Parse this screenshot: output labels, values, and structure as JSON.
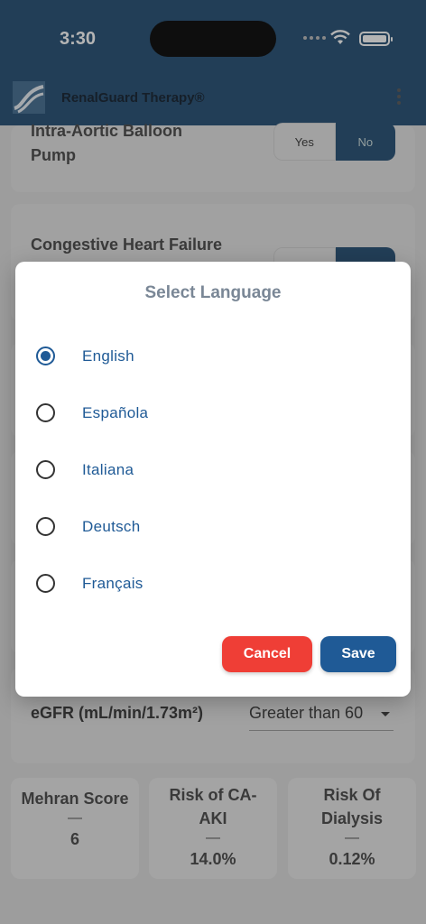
{
  "status_bar": {
    "time": "3:30"
  },
  "app": {
    "title": "RenalGuard Therapy®"
  },
  "background": {
    "balloon_pump": {
      "label_line1": "Intra-Aortic Balloon",
      "label_line2": "Pump",
      "yes": "Yes",
      "no": "No"
    },
    "heart_failure": {
      "label": "Congestive Heart Failure"
    },
    "egfr": {
      "label": "eGFR (mL/min/1.73m²)",
      "value": "Greater than 60"
    },
    "scores": [
      {
        "title": "Mehran Score",
        "dash": "—",
        "value": "6"
      },
      {
        "title": "Risk of CA-AKI",
        "dash": "—",
        "value": "14.0%"
      },
      {
        "title": "Risk Of Dialysis",
        "dash": "—",
        "value": "0.12%"
      }
    ]
  },
  "dialog": {
    "title": "Select Language",
    "options": [
      {
        "label": "English",
        "selected": true
      },
      {
        "label": "Española",
        "selected": false
      },
      {
        "label": "Italiana",
        "selected": false
      },
      {
        "label": "Deutsch",
        "selected": false
      },
      {
        "label": "Français",
        "selected": false
      }
    ],
    "cancel_label": "Cancel",
    "save_label": "Save"
  },
  "colors": {
    "header": "#1f4a70",
    "accent": "#1f5a96",
    "cancel": "#ef3e36"
  }
}
